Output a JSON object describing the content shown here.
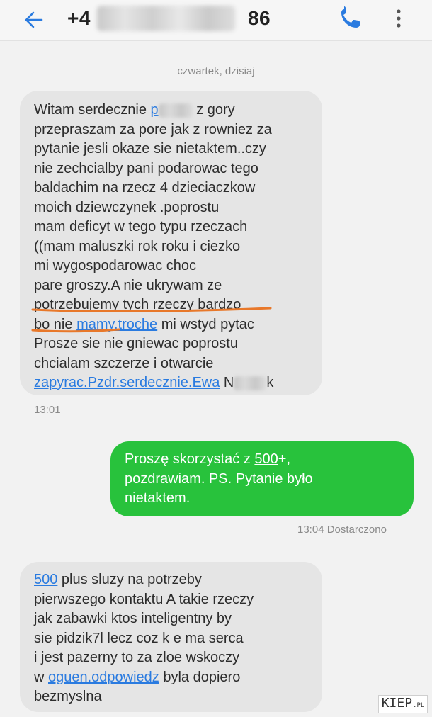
{
  "header": {
    "phone_number": "+4",
    "phone_number_tail": "86"
  },
  "date_separator": "czwartek, dzisiaj",
  "messages": [
    {
      "direction": "incoming",
      "lines": [
        {
          "a": "Witam serdecznie ",
          "link": "p",
          "b": "  z  gory"
        },
        {
          "a": "przepraszam za pore jak z rowniez za"
        },
        {
          "a": "pytanie jesli okaze sie nietaktem..czy"
        },
        {
          "a": "nie zechcialby pani podarowac tego"
        },
        {
          "a": "baldachim  na rzecz 4 dzieciaczkow"
        },
        {
          "a": "moich dziewczynek .poprostu"
        },
        {
          "a": "mam deficyt w tego typu rzeczach"
        },
        {
          "a": "((mam maluszki rok roku i ciezko"
        },
        {
          "a": "mi wygospodarowac choc"
        },
        {
          "a": "pare groszy.A nie ukrywam ze"
        },
        {
          "a": "potrzebujemy tych rzeczy bardzo"
        },
        {
          "a": "bo nie ",
          "link": "mamy.troche",
          "b": " mi wstyd pytac"
        },
        {
          "a": "Prosze sie nie gniewac poprostu"
        },
        {
          "a": "chcialam szczerze i otwarcie"
        },
        {
          "link": "zapyrac.Pzdr.serdecznie.Ewa",
          "b": " N",
          "c": "k"
        }
      ],
      "time": "13:01"
    },
    {
      "direction": "outgoing",
      "lines": [
        {
          "a": "Proszę skorzystać z ",
          "link": "500",
          "b": "+,"
        },
        {
          "a": "pozdrawiam. PS. Pytanie było"
        },
        {
          "a": "nietaktem."
        }
      ],
      "time": "13:04 Dostarczono"
    },
    {
      "direction": "incoming",
      "lines": [
        {
          "link": "500",
          "b": " plus sluzy na potrzeby"
        },
        {
          "a": "pierwszego kontaktu A takie rzeczy"
        },
        {
          "a": "jak zabawki ktos inteligentny by"
        },
        {
          "a": "sie pidzik7l lecz coz k e ma serca"
        },
        {
          "a": "i jest pazerny to za zloe wskoczy"
        },
        {
          "a": "w ",
          "link": "oguen.odpowiedz",
          "b": " byla dopiero"
        },
        {
          "a": "bezmyslna"
        }
      ]
    }
  ],
  "watermark": {
    "main": "KIEP",
    "suffix": ".PL"
  },
  "colors": {
    "incoming_bubble": "#e5e5e5",
    "outgoing_bubble": "#28c23c",
    "link": "#2a7be0",
    "accent_blue": "#2a7be0",
    "annotation_orange": "#e8782a"
  },
  "icons": [
    "back-arrow-icon",
    "phone-icon",
    "more-vertical-icon"
  ]
}
